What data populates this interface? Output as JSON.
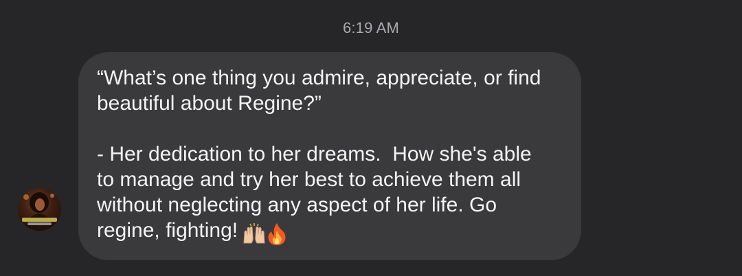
{
  "chat": {
    "timestamp": "6:19 AM",
    "message": {
      "text": "“What’s one thing you admire, appreciate, or find\nbeautiful about Regine?”\n\n- Her dedication to her dreams.  How she's able\nto manage and try her best to achieve them all\nwithout neglecting any aspect of her life. Go\nregine, fighting!",
      "emojis": [
        "raising-hands-emoji",
        "fire-emoji"
      ]
    },
    "sender": {
      "avatar_icon": "profile-avatar"
    }
  },
  "colors": {
    "background": "#262628",
    "bubble": "#3a3a3c",
    "text": "#f4f4f4",
    "timestamp": "#a9a9ad"
  }
}
